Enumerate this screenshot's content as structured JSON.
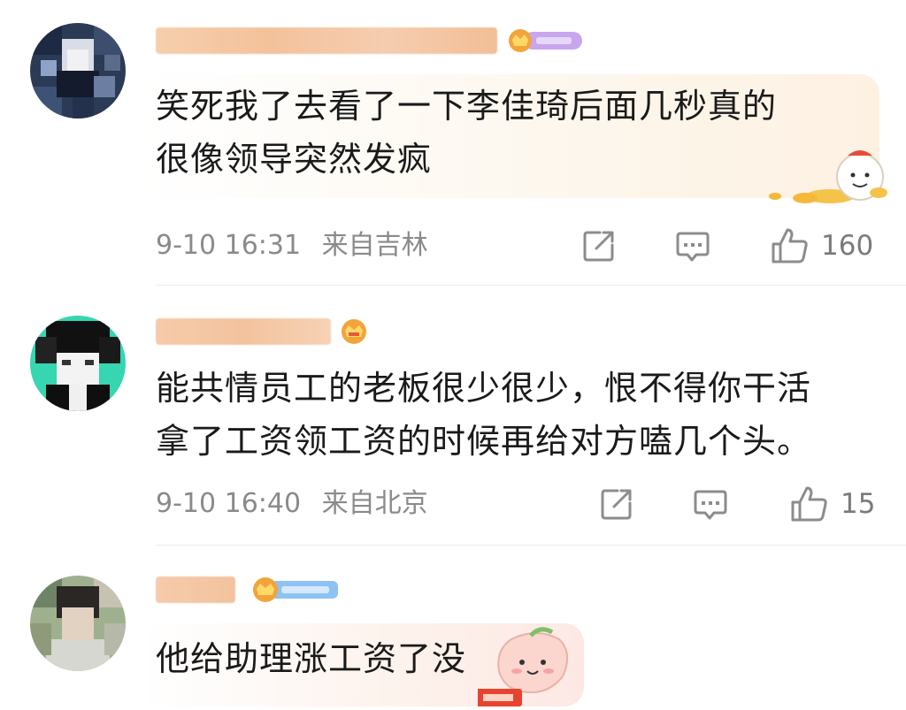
{
  "comments": [
    {
      "username": "",
      "text": "笑死我了去看了一下李佳琦后面几秒真的\n很像领导突然发疯",
      "time": "9-10 16:31",
      "location": "来自吉林",
      "likes": "160",
      "icons": [
        "repost-icon",
        "comment-icon",
        "like-icon"
      ]
    },
    {
      "username": "",
      "text": "能共情员工的老板很少很少，恨不得你干活\n拿了工资领工资的时候再给对方嗑几个头。",
      "time": "9-10 16:40",
      "location": "来自北京",
      "likes": "15",
      "icons": [
        "repost-icon",
        "comment-icon",
        "like-icon"
      ]
    },
    {
      "username": "",
      "text": "他给助理涨工资了没",
      "time": "",
      "location": "",
      "likes": "",
      "icons": []
    }
  ],
  "colors": {
    "meta_text": "#8a8a8a",
    "body_text": "#1a1a1a",
    "icon_gray": "#8c8c8c",
    "divider": "#ececec",
    "username_blur": "#f4c9a6",
    "badge_gold": "#f2a43a",
    "badge_purple": "#b88de6",
    "badge_blue": "#6aa8e8"
  }
}
